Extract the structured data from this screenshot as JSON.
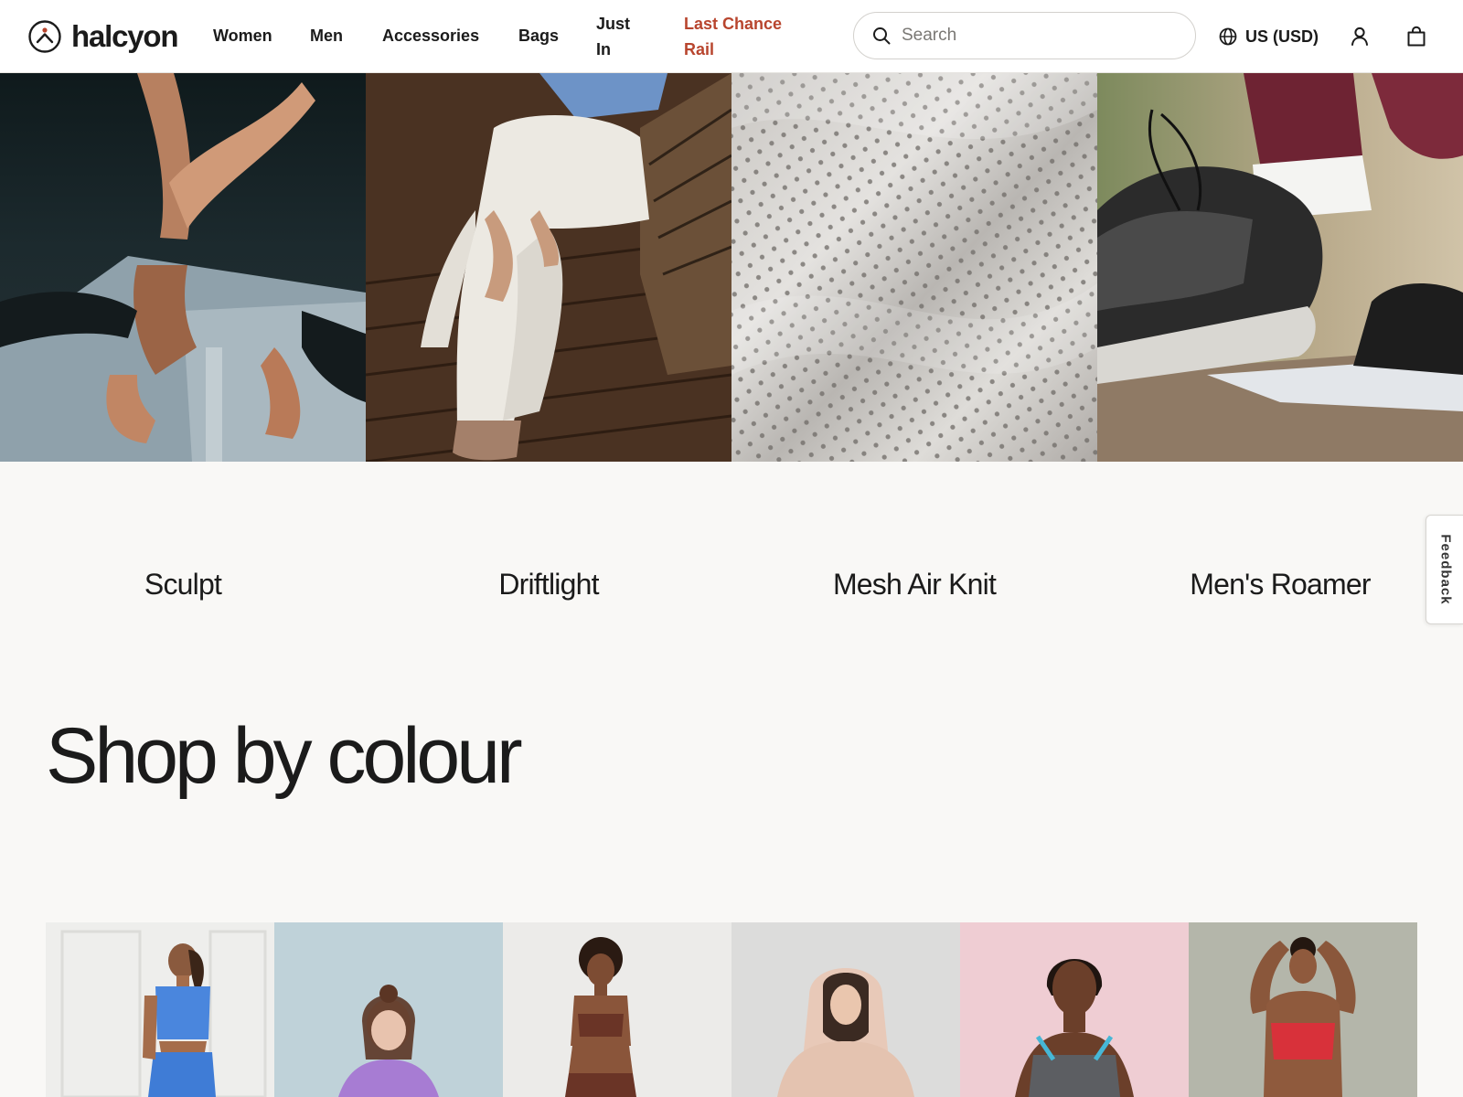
{
  "brand": {
    "name": "halcyon",
    "logo_icon": "halcyon-logo-mark"
  },
  "nav": {
    "items": [
      {
        "label": "Women",
        "highlight": false
      },
      {
        "label": "Men",
        "highlight": false
      },
      {
        "label": "Accessories",
        "highlight": false
      },
      {
        "label": "Bags",
        "highlight": false
      },
      {
        "label": "Just In",
        "highlight": false
      },
      {
        "label": "Last Chance Rail",
        "highlight": true
      }
    ]
  },
  "search": {
    "placeholder": "Search",
    "value": "",
    "icon": "search-icon"
  },
  "locale": {
    "label": "US (USD)",
    "icon": "globe-icon"
  },
  "account": {
    "icon": "user-icon"
  },
  "cart": {
    "icon": "shopping-bag-icon"
  },
  "collections": [
    {
      "label": "Sculpt",
      "image": "hands-stretching-photo"
    },
    {
      "label": "Driftlight",
      "image": "seated-white-trousers-photo"
    },
    {
      "label": "Mesh Air Knit",
      "image": "mesh-fabric-photo"
    },
    {
      "label": "Men's Roamer",
      "image": "running-shoe-photo"
    }
  ],
  "feedback": {
    "label": "Feedback"
  },
  "colour_section": {
    "title": "Shop by colour",
    "swatches": [
      {
        "image": "model-blue-outfit-photo"
      },
      {
        "image": "model-lilac-jacket-photo"
      },
      {
        "image": "model-brown-set-photo"
      },
      {
        "image": "model-pink-hoodie-photo"
      },
      {
        "image": "model-grey-sports-bra-photo"
      },
      {
        "image": "model-red-top-photo"
      }
    ]
  },
  "colors": {
    "accent_sale": "#b8452e",
    "page_bg": "#f9f8f6",
    "text": "#1b1b1b"
  }
}
